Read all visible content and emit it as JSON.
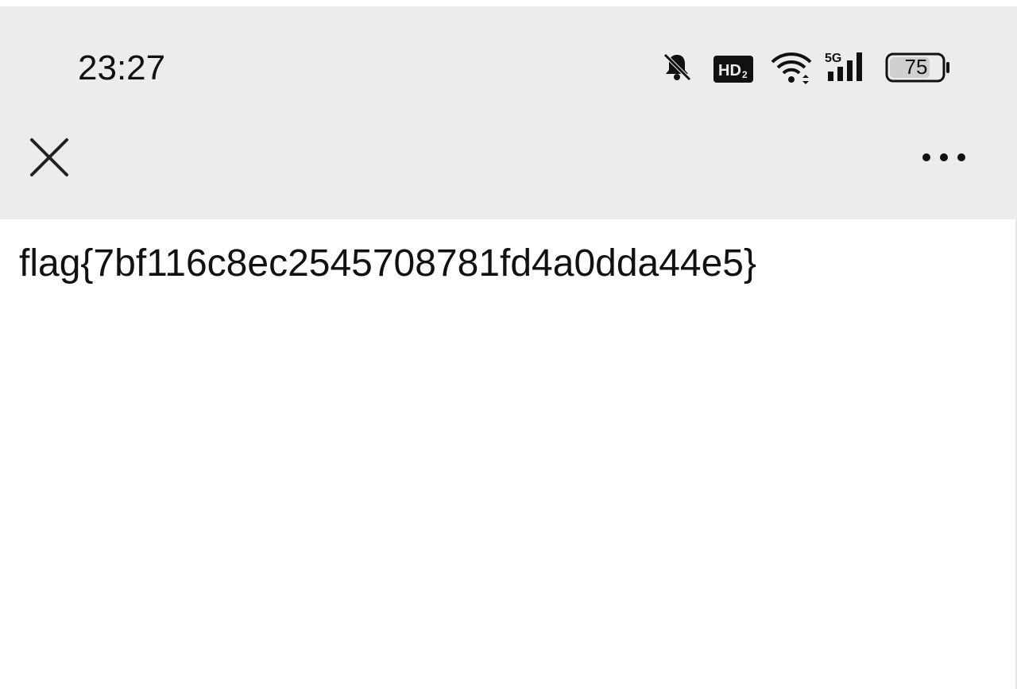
{
  "status_bar": {
    "time": "23:27",
    "icons": [
      "bell-muted-icon",
      "hd2-icon",
      "wifi-icon",
      "5g-signal-icon",
      "battery-icon"
    ],
    "hd_label": "HD2",
    "network_label": "5G",
    "battery_level": "75"
  },
  "toolbar": {
    "close_icon": "close-icon",
    "more_icon": "more-horizontal-icon"
  },
  "content": {
    "text": "flag{7bf116c8ec2545708781fd4a0dda44e5}"
  }
}
